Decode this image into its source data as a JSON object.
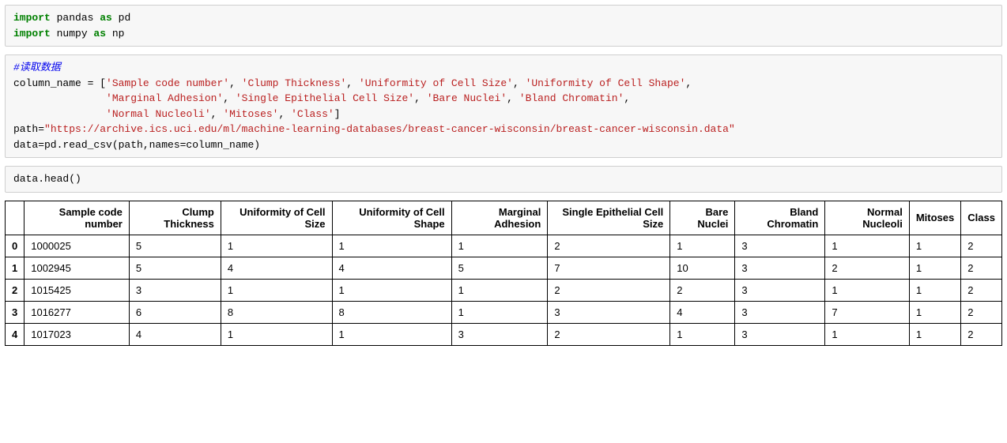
{
  "code_cell_1": {
    "kw_import_1": "import",
    "mod_1": " pandas ",
    "kw_as_1": "as",
    "alias_1": " pd",
    "kw_import_2": "import",
    "mod_2": " numpy ",
    "kw_as_2": "as",
    "alias_2": " np"
  },
  "code_cell_2": {
    "comment": "#读取数据",
    "line1_pre": "column_name = [",
    "s1": "'Sample code number'",
    "sep": ", ",
    "s2": "'Clump Thickness'",
    "s3": "'Uniformity of Cell Size'",
    "s4": "'Uniformity of Cell Shape'",
    "eol1": ",",
    "indent2": "               ",
    "s5": "'Marginal Adhesion'",
    "s6": "'Single Epithelial Cell Size'",
    "s7": "'Bare Nuclei'",
    "s8": "'Bland Chromatin'",
    "eol2": ",",
    "indent3": "               ",
    "s9": "'Normal Nucleoli'",
    "s10": "'Mitoses'",
    "s11": "'Class'",
    "close_list": "]",
    "path_pre": "path=",
    "path_str": "\"https://archive.ics.uci.edu/ml/machine-learning-databases/breast-cancer-wisconsin/breast-cancer-wisconsin.data\"",
    "read_csv": "data=pd.read_csv(path,names=column_name)"
  },
  "code_cell_3": {
    "line": "data.head()"
  },
  "chart_data": {
    "type": "table",
    "columns": [
      "",
      "Sample code number",
      "Clump Thickness",
      "Uniformity of Cell Size",
      "Uniformity of Cell Shape",
      "Marginal Adhesion",
      "Single Epithelial Cell Size",
      "Bare Nuclei",
      "Bland Chromatin",
      "Normal Nucleoli",
      "Mitoses",
      "Class"
    ],
    "rows": [
      {
        "idx": "0",
        "sample": "1000025",
        "clump": "5",
        "size": "1",
        "shape": "1",
        "adhesion": "1",
        "epi": "2",
        "nuclei": "1",
        "chrom": "3",
        "nucleoli": "1",
        "mitoses": "1",
        "class": "2"
      },
      {
        "idx": "1",
        "sample": "1002945",
        "clump": "5",
        "size": "4",
        "shape": "4",
        "adhesion": "5",
        "epi": "7",
        "nuclei": "10",
        "chrom": "3",
        "nucleoli": "2",
        "mitoses": "1",
        "class": "2"
      },
      {
        "idx": "2",
        "sample": "1015425",
        "clump": "3",
        "size": "1",
        "shape": "1",
        "adhesion": "1",
        "epi": "2",
        "nuclei": "2",
        "chrom": "3",
        "nucleoli": "1",
        "mitoses": "1",
        "class": "2"
      },
      {
        "idx": "3",
        "sample": "1016277",
        "clump": "6",
        "size": "8",
        "shape": "8",
        "adhesion": "1",
        "epi": "3",
        "nuclei": "4",
        "chrom": "3",
        "nucleoli": "7",
        "mitoses": "1",
        "class": "2"
      },
      {
        "idx": "4",
        "sample": "1017023",
        "clump": "4",
        "size": "1",
        "shape": "1",
        "adhesion": "3",
        "epi": "2",
        "nuclei": "1",
        "chrom": "3",
        "nucleoli": "1",
        "mitoses": "1",
        "class": "2"
      }
    ]
  }
}
